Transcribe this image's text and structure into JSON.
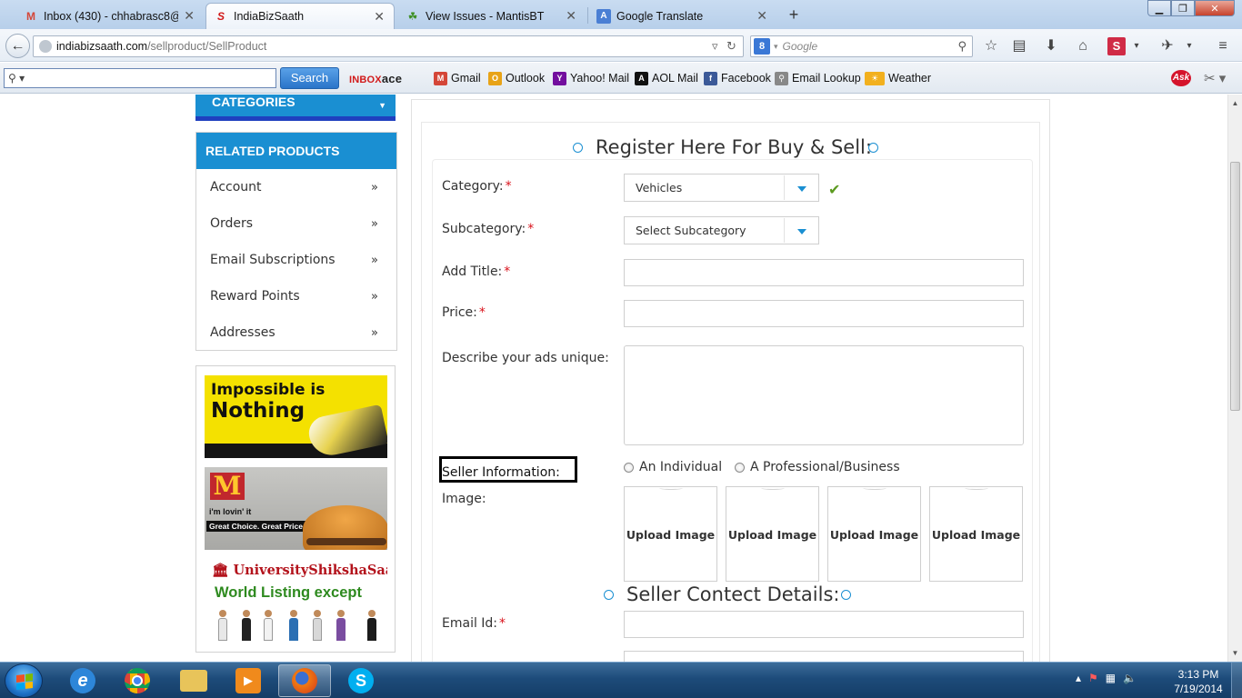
{
  "browser": {
    "tabs": [
      {
        "label": "Inbox (430) - chhabrasc8@...",
        "icon": "gmail-icon",
        "active": false
      },
      {
        "label": "IndiaBizSaath",
        "icon": "indiabizsaath-icon",
        "active": true
      },
      {
        "label": "View Issues - MantisBT",
        "icon": "mantis-icon",
        "active": false
      },
      {
        "label": "Google Translate",
        "icon": "translate-icon",
        "active": false
      }
    ],
    "new_tab": "+",
    "url_host": "indiabizsaath.com",
    "url_path": "/sellproduct/SellProduct",
    "search_placeholder": "Google"
  },
  "toolbar": {
    "search_button": "Search",
    "brand": "INBOX",
    "brand_suffix": "ace",
    "bookmarks": [
      {
        "label": "Gmail",
        "icon": "gmail-icon",
        "color": "#d44638",
        "glyph": "M"
      },
      {
        "label": "Outlook",
        "icon": "outlook-icon",
        "color": "#e8a317",
        "glyph": "O"
      },
      {
        "label": "Yahoo! Mail",
        "icon": "yahoo-icon",
        "color": "#720e9e",
        "glyph": "Y"
      },
      {
        "label": "AOL Mail",
        "icon": "aol-icon",
        "color": "#111111",
        "glyph": "A"
      },
      {
        "label": "Facebook",
        "icon": "facebook-icon",
        "color": "#3b5998",
        "glyph": "f"
      },
      {
        "label": "Email Lookup",
        "icon": "magnifier-icon",
        "color": "#888888",
        "glyph": "Q"
      },
      {
        "label": "Weather",
        "icon": "weather-icon",
        "color": "#f2b01e",
        "glyph": "*"
      }
    ],
    "ask_label": "Ask"
  },
  "sidebar": {
    "categories_label": "CATEGORIES",
    "related_title": "RELATED PRODUCTS",
    "items": [
      {
        "label": "Account"
      },
      {
        "label": "Orders"
      },
      {
        "label": "Email Subscriptions"
      },
      {
        "label": "Reward Points"
      },
      {
        "label": "Addresses"
      }
    ],
    "chevron": "»",
    "ads": {
      "ad1_line1": "Impossible is",
      "ad1_line2": "Nothing",
      "ad2_logo": "M",
      "ad2_tagline": "i'm lovin' it",
      "ad2_slogan": "Great Choice. Great Price.",
      "ad3_brand": "UniversityShikshaSaath",
      "ad3_text": "World Listing except"
    }
  },
  "form": {
    "heading": "Register Here For Buy & Sell:",
    "category_label": "Category:",
    "category_value": "Vehicles",
    "subcategory_label": "Subcategory:",
    "subcategory_value": "Select Subcategory",
    "title_label": "Add Title:",
    "price_label": "Price:",
    "describe_label": "Describe your ads unique:",
    "seller_info_label": "Seller Information:",
    "seller_options": [
      "An Individual",
      "A Professional/Business"
    ],
    "image_label": "Image:",
    "upload_label": "Upload Image",
    "required_mark": "*",
    "contact_heading": "Seller Contect Details:",
    "email_label": "Email Id:"
  },
  "taskbar": {
    "time": "3:13 PM",
    "date": "7/19/2014"
  },
  "colors": {
    "accent": "#1a8fd2",
    "required": "#d9121b",
    "valid": "#5b9a1f"
  }
}
